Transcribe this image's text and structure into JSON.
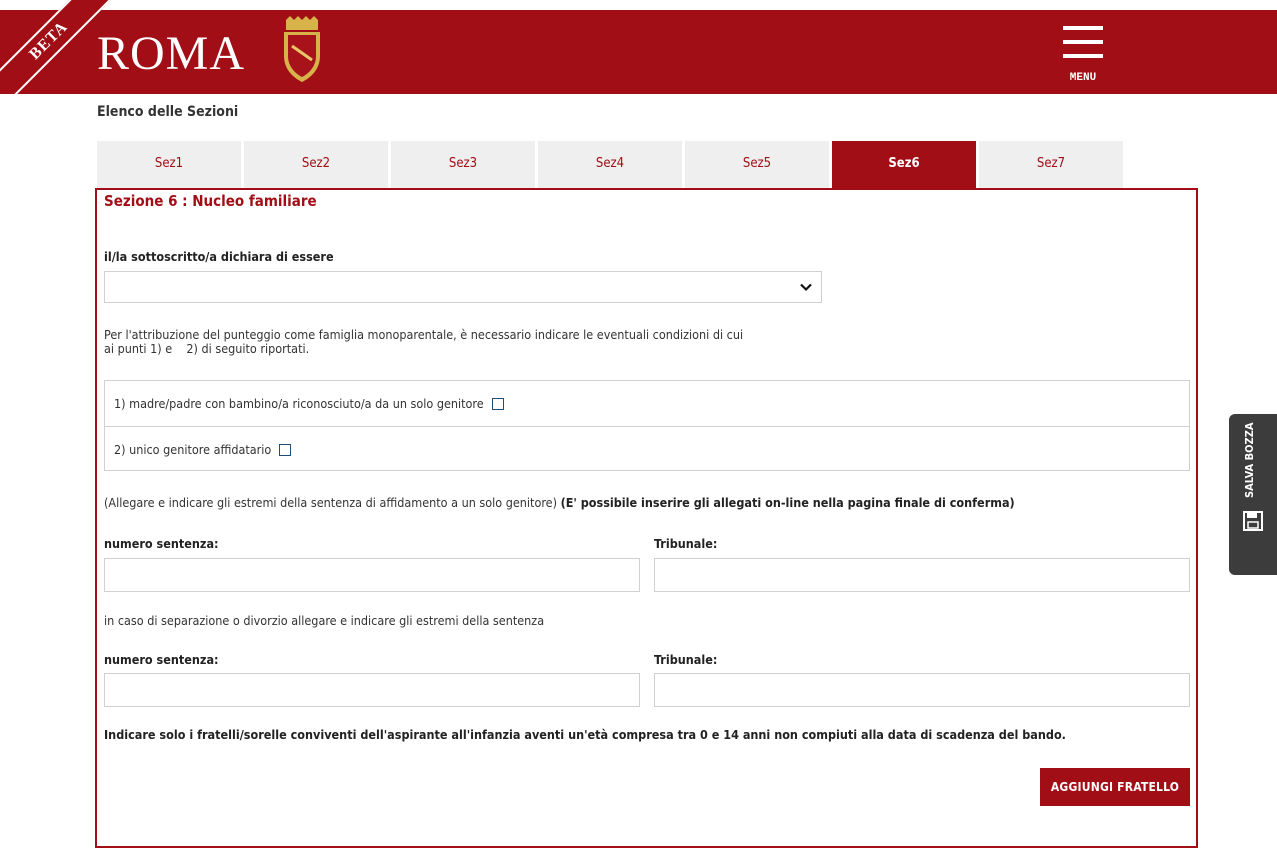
{
  "header": {
    "beta_label": "BETA",
    "logo_text": "ROMA",
    "menu_label": "MENU"
  },
  "sections": {
    "title": "Elenco delle Sezioni",
    "tabs": [
      {
        "label": "Sez1",
        "active": false
      },
      {
        "label": "Sez2",
        "active": false
      },
      {
        "label": "Sez3",
        "active": false
      },
      {
        "label": "Sez4",
        "active": false
      },
      {
        "label": "Sez5",
        "active": false
      },
      {
        "label": "Sez6",
        "active": true
      },
      {
        "label": "Sez7",
        "active": false
      }
    ]
  },
  "form": {
    "title": "Sezione 6 : Nucleo familiare",
    "declare_label": "il/la sottoscritto/a dichiara di essere",
    "declare_value": "",
    "monoparental_info_line1": "Per l'attribuzione del punteggio come famiglia monoparentale, è necessario indicare le eventuali condizioni di cui",
    "monoparental_info_line2": "ai punti 1) e    2) di seguito riportati.",
    "condition_1": "1) madre/padre con bambino/a riconosciuto/a da un solo genitore",
    "condition_2": "2) unico genitore affidatario",
    "attach_note_normal": "(Allegare e indicare gli estremi della sentenza di affidamento a un solo genitore)",
    "attach_note_bold": "(E' possibile inserire gli allegati on-line nella pagina finale di conferma)",
    "sentence_number_label": "numero sentenza:",
    "tribunal_label": "Tribunale:",
    "separation_note": "in caso di separazione o divorzio allegare e indicare gli estremi della sentenza",
    "sentence_number_label_2": "numero sentenza:",
    "tribunal_label_2": "Tribunale:",
    "siblings_note": "Indicare solo i fratelli/sorelle conviventi dell'aspirante all'infanzia aventi un'età compresa tra 0 e 14 anni non compiuti alla data di scadenza del bando.",
    "add_sibling_button": "AGGIUNGI FRATELLO"
  },
  "side": {
    "save_draft_label": "SALVA BOZZA"
  },
  "colors": {
    "brand": "#a10e16",
    "tab_inactive_bg": "#efefef",
    "side_button_bg": "#3c3c3c"
  }
}
